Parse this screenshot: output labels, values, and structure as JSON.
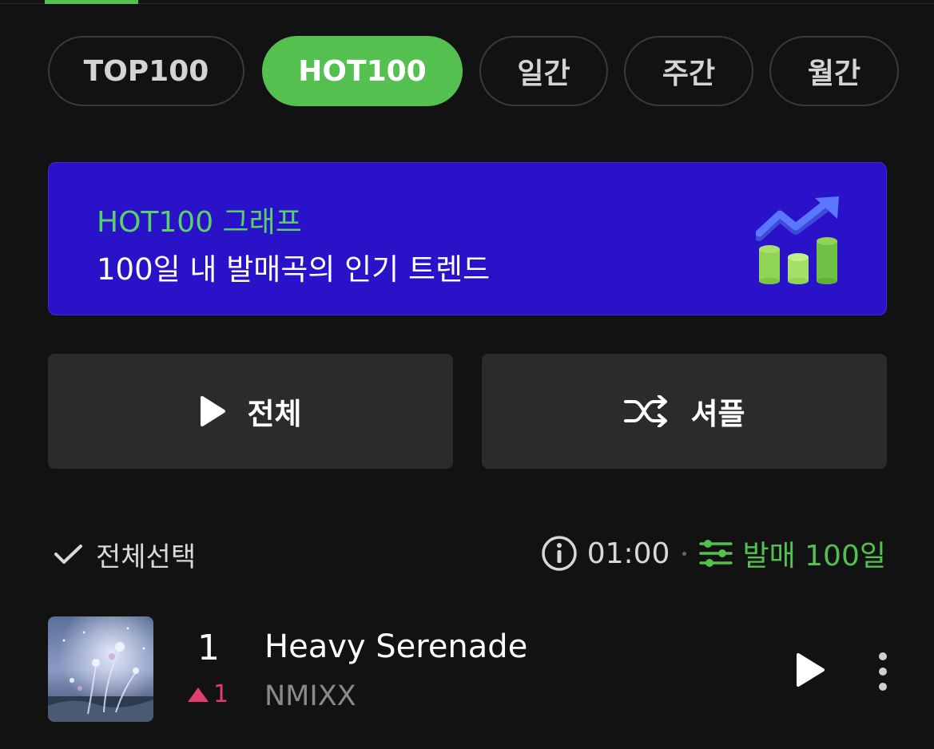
{
  "tabs": [
    {
      "label": "TOP100",
      "active": false
    },
    {
      "label": "HOT100",
      "active": true
    },
    {
      "label": "일간",
      "active": false
    },
    {
      "label": "주간",
      "active": false
    },
    {
      "label": "월간",
      "active": false
    }
  ],
  "banner": {
    "title": "HOT100 그래프",
    "subtitle": "100일 내 발매곡의 인기 트렌드",
    "graphic_icon": "trend-chart-icon"
  },
  "actions": {
    "play_all_label": "전체",
    "shuffle_label": "셔플"
  },
  "list_header": {
    "select_all_label": "전체선택",
    "time": "01:00",
    "filter_label": "발매 100일"
  },
  "tracks": [
    {
      "rank": "1",
      "rank_change": "1",
      "rank_direction": "up",
      "title": "Heavy Serenade",
      "artist": "NMIXX"
    }
  ],
  "colors": {
    "accent": "#53c04f",
    "background": "#121212",
    "banner": "#2a12c9",
    "button": "#2b2b2b",
    "rank_up": "#e23d6e"
  }
}
